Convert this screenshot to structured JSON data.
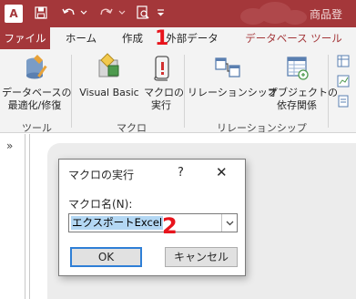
{
  "app": {
    "logo_letter": "A",
    "document_title": "商品登"
  },
  "tabs": [
    {
      "label": "ファイル"
    },
    {
      "label": "ホーム"
    },
    {
      "label": "作成"
    },
    {
      "label": "外部データ"
    },
    {
      "label": "データベース ツール"
    }
  ],
  "annotations": {
    "step1": "1",
    "step2": "2"
  },
  "ribbon": {
    "tools": {
      "optimize_label_line1": "データベースの",
      "optimize_label_line2": "最適化/修復",
      "group_label": "ツール"
    },
    "macro": {
      "vb_label": "Visual Basic",
      "run_label_line1": "マクロの",
      "run_label_line2": "実行",
      "group_label": "マクロ"
    },
    "relations": {
      "relationship_label": "リレーションシップ",
      "dependency_label_line1": "オブジェクトの",
      "dependency_label_line2": "依存関係",
      "group_label": "リレーションシップ"
    }
  },
  "nav": {
    "toggle": "»"
  },
  "dialog": {
    "title": "マクロの実行",
    "help": "?",
    "close": "✕",
    "field_label": "マクロ名(N):",
    "field_value": "エクスポートExcel",
    "ok_label": "OK",
    "cancel_label": "キャンセル"
  },
  "colors": {
    "accent": "#a4373a",
    "annotation": "#e8141c",
    "focus": "#2f7fd6"
  }
}
